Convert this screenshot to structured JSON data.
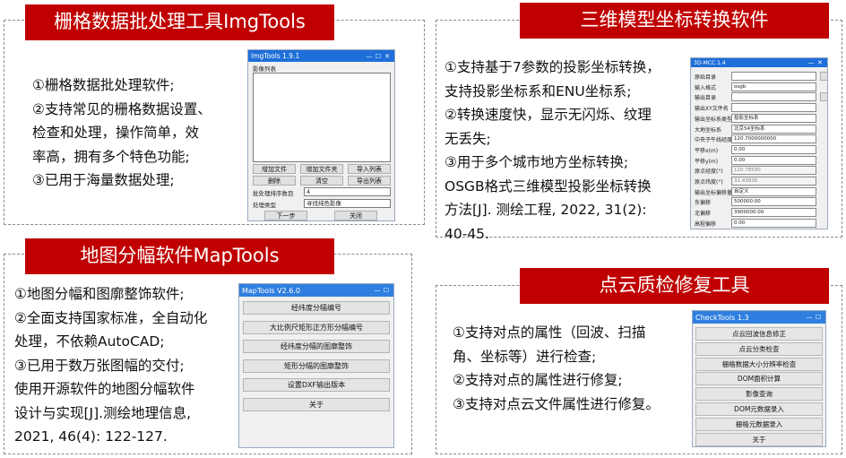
{
  "panels": {
    "imgtools": {
      "title": "栅格数据批处理工具ImgTools",
      "desc": [
        "①栅格数据批处理软件;",
        "②支持常见的栅格数据设置、",
        "检查和处理，操作简单，效",
        "率高，拥有多个特色功能;",
        "③已用于海量数据处理;"
      ],
      "window": {
        "title": "ImgTools 1.9.1",
        "list_label": "影像列表",
        "buttons_row1": [
          "增加文件",
          "增加文件夹",
          "导入列表"
        ],
        "buttons_row2": [
          "删除",
          "清空",
          "导出列表"
        ],
        "order_label": "批处理排序数目",
        "order_value": "4",
        "type_label": "处理类型",
        "type_value": "寻找纯色影像",
        "next_button": "下一步",
        "close_button": "关闭"
      }
    },
    "osgb": {
      "title": "三维模型坐标转换软件",
      "desc": [
        "①支持基于7参数的投影坐标转换，",
        "支持投影坐标系和ENU坐标系;",
        "②转换速度快，显示无闪烁、纹理",
        "无丢失;",
        "③用于多个城市地方坐标转换;",
        "OSGB格式三维模型投影坐标转换",
        "方法[J]. 测绘工程, 2022, 31(2):",
        "40-45."
      ],
      "window": {
        "title": "3D-MCC 1.4",
        "rows": [
          {
            "label": "原始目录",
            "value": "",
            "button": true
          },
          {
            "label": "输入格式",
            "value": "osgb",
            "button": false
          },
          {
            "label": "输出目录",
            "value": "",
            "button": true
          },
          {
            "label": "输出XY文件名",
            "value": "",
            "button": false
          },
          {
            "label": "输出坐标系类型",
            "value": "投影坐标系",
            "button": false
          },
          {
            "label": "大地坐标系",
            "value": "北京54坐标系",
            "button": false
          },
          {
            "label": "中央子午线经度(°)",
            "value": "120.7000000000",
            "button": false
          },
          {
            "label": "平移x(m)",
            "value": "0.00",
            "button": false
          },
          {
            "label": "平移y(m)",
            "value": "0.00",
            "button": false
          },
          {
            "label": "原点经度(°)",
            "value": "120.78590",
            "button": false
          },
          {
            "label": "原点纬度(°)",
            "value": "31.43836",
            "button": false
          },
          {
            "label": "输出坐标偏移量",
            "value": "自定义",
            "button": false
          },
          {
            "label": "东偏移",
            "value": "500000.00",
            "button": false
          },
          {
            "label": "北偏移",
            "value": "3900000.00",
            "button": false
          },
          {
            "label": "高程偏移",
            "value": "0.00",
            "button": false
          }
        ]
      }
    },
    "maptools": {
      "title": "地图分幅软件MapTools",
      "desc": [
        "①地图分幅和图廓整饰软件;",
        "②全面支持国家标准，全自动化",
        "处理，不依赖AutoCAD;",
        "③已用于数万张图幅的交付;",
        " 使用开源软件的地图分幅软件",
        "设计与实现[J].测绘地理信息,",
        "2021, 46(4): 122-127."
      ],
      "window": {
        "title": "MapTools V2.6.0",
        "buttons": [
          "经纬度分幅编号",
          "大比例尺矩形正方形分幅编号",
          "经纬度分幅的图廓整饰",
          "矩形分幅的图廓整饰",
          "设置DXF输出版本",
          "关于"
        ]
      }
    },
    "checktools": {
      "title": "点云质检修复工具",
      "desc": [
        "①支持对点的属性（回波、扫描",
        "角、坐标等）进行检查;",
        "②支持对点的属性进行修复;",
        "③支持对点云文件属性进行修复。"
      ],
      "window": {
        "title": "CheckTools 1.3",
        "buttons": [
          "点云回波信息修正",
          "点云分类检查",
          "栅格数据大小分辨率检查",
          "DOM面积计算",
          "影像查询",
          "DOM元数据录入",
          "栅格元数据录入",
          "关于"
        ]
      }
    }
  }
}
